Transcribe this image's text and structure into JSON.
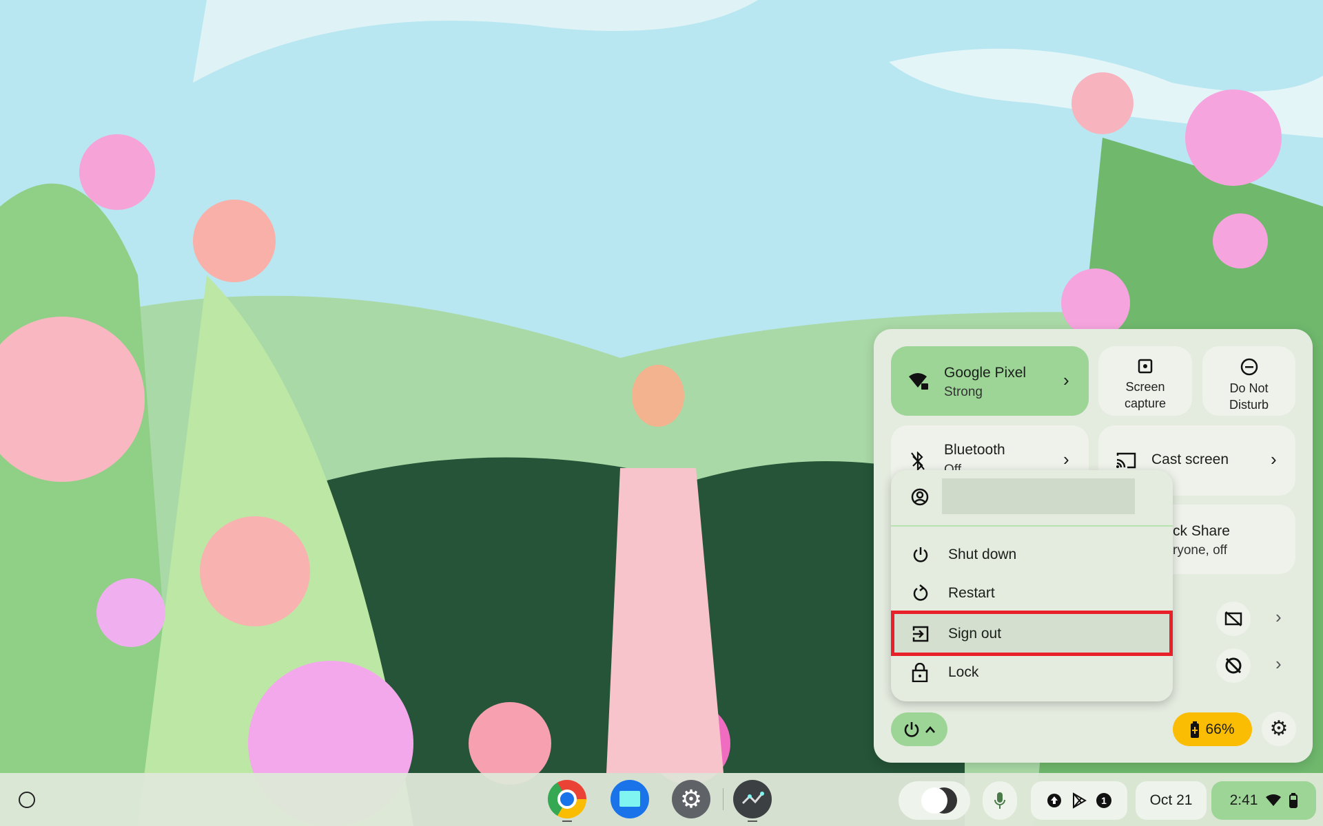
{
  "quick_settings": {
    "network": {
      "name": "Google Pixel",
      "status": "Strong",
      "icon": "wifi-lock-icon"
    },
    "screen_capture": {
      "label_line1": "Screen",
      "label_line2": "capture"
    },
    "do_not_disturb": {
      "label_line1": "Do Not",
      "label_line2": "Disturb"
    },
    "bluetooth": {
      "name": "Bluetooth",
      "status": "Off"
    },
    "cast": {
      "label": "Cast screen"
    },
    "quick_share": {
      "name": "ck Share",
      "status": "ryone, off"
    },
    "battery": {
      "percent": "66%",
      "color": "#fbbc04"
    }
  },
  "power_menu": {
    "items": [
      {
        "label": "Shut down",
        "icon": "power-icon"
      },
      {
        "label": "Restart",
        "icon": "restart-icon"
      },
      {
        "label": "Sign out",
        "icon": "sign-out-icon",
        "highlighted": true
      },
      {
        "label": "Lock",
        "icon": "lock-icon"
      }
    ]
  },
  "shelf": {
    "apps": [
      "Chrome",
      "Files",
      "Settings",
      "Diagnostics"
    ],
    "date": "Oct 21",
    "time": "2:41",
    "notification_count": "1"
  },
  "colors": {
    "accent_green": "#9dd597",
    "highlight_border": "#e8202a"
  }
}
